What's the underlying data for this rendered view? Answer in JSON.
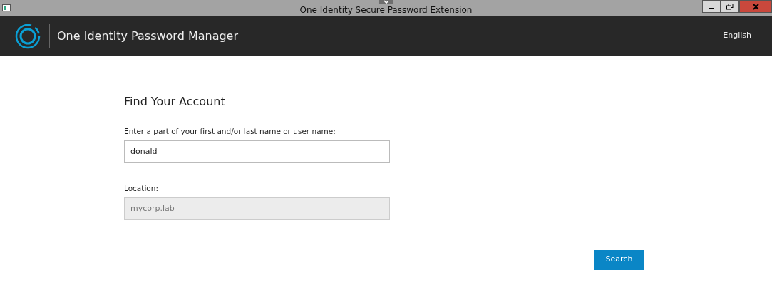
{
  "window": {
    "title": "One Identity Secure Password Extension"
  },
  "header": {
    "app_name": "One Identity Password Manager",
    "language": "English"
  },
  "form": {
    "title": "Find Your Account",
    "fields": [
      {
        "label": "Enter a part of your first and/or last name or user name:",
        "value": "donald",
        "disabled": false
      },
      {
        "label": "Location:",
        "value": "mycorp.lab",
        "disabled": true
      }
    ],
    "button": "Search"
  }
}
